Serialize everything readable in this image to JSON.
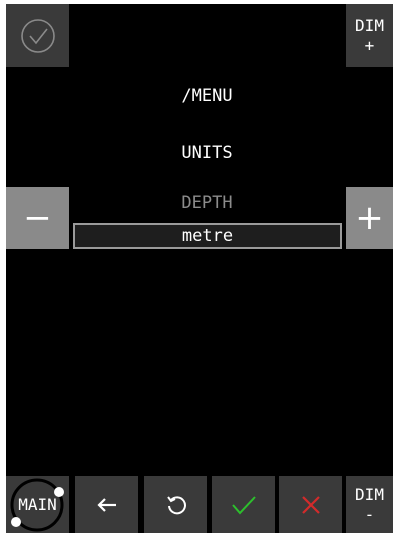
{
  "header": {
    "dim_up": {
      "label": "DIM",
      "sign": "+"
    }
  },
  "menu": {
    "path": "/MENU",
    "section": "UNITS",
    "parameter": "DEPTH",
    "value": "metre"
  },
  "side": {
    "minus": "−",
    "plus": "+"
  },
  "footer": {
    "main_label": "MAIN",
    "dim_down": {
      "label": "DIM",
      "sign": "-"
    }
  },
  "icons": {
    "confirm_top": "check-circle-icon",
    "back": "arrow-left-icon",
    "reset": "rotate-ccw-icon",
    "ok": "check-icon",
    "cancel": "close-icon",
    "main": "main-dial-icon"
  },
  "colors": {
    "ok": "#2dbf2d",
    "cancel": "#d22b2b",
    "button": "#3a3a3a",
    "button_light": "#8a8a8a",
    "dim_text": "#8c8c8c"
  }
}
